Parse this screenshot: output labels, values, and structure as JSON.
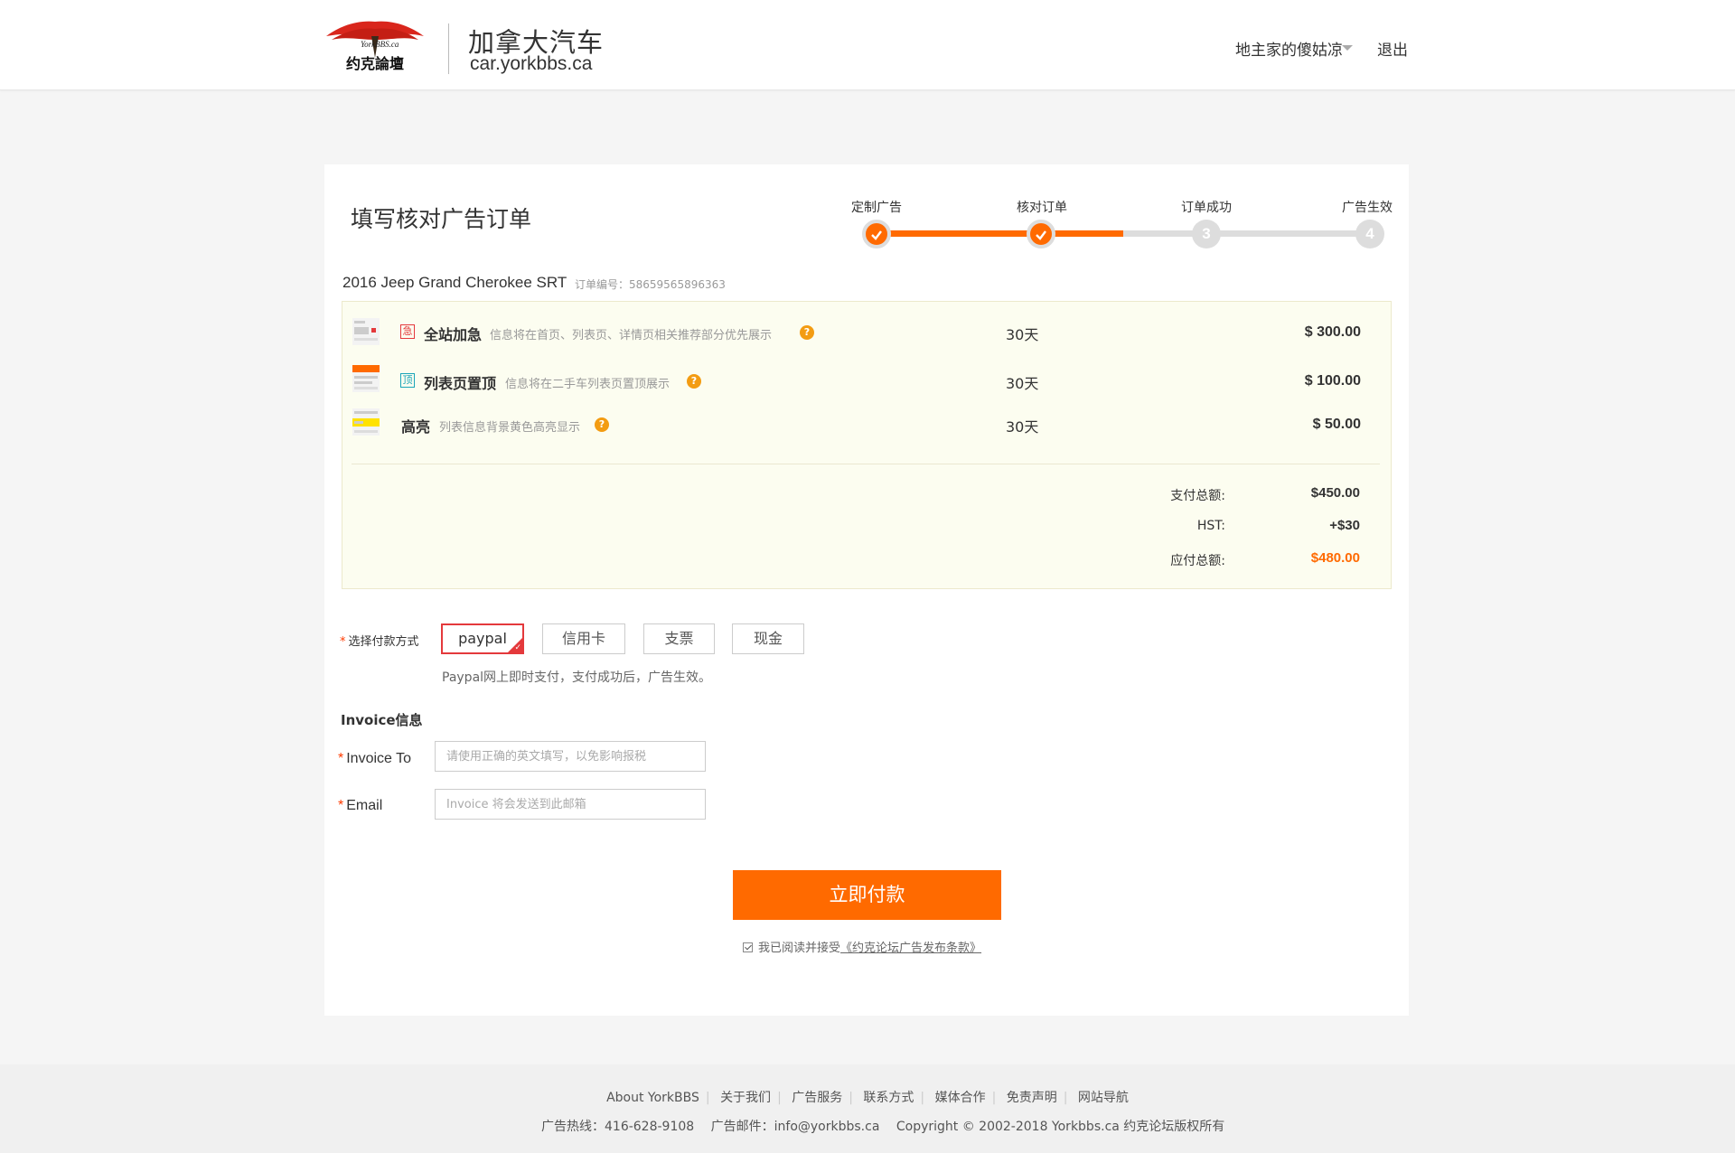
{
  "header": {
    "site_title": "加拿大汽车",
    "site_url": "car.yorkbbs.ca",
    "logo_text": "YorkBBS.ca 约克论坛",
    "user_name": "地主家的傻姑凉",
    "logout": "退出"
  },
  "page": {
    "title": "填写核对广告订单",
    "steps": [
      {
        "label": "定制广告",
        "number": "1",
        "status": "done"
      },
      {
        "label": "核对订单",
        "number": "2",
        "status": "done"
      },
      {
        "label": "订单成功",
        "number": "3",
        "status": "pending"
      },
      {
        "label": "广告生效",
        "number": "4",
        "status": "pending"
      }
    ],
    "progress_fraction": 0.5
  },
  "order": {
    "car_title": "2016 Jeep Grand Cherokee SRT",
    "order_no": "订单编号：58659565896363",
    "items": [
      {
        "badge": "急",
        "name": "全站加急",
        "desc": "信息将在首页、列表页、详情页相关推荐部分优先展示",
        "help": "?",
        "days": "30天",
        "price": "$ 300.00"
      },
      {
        "badge": "顶",
        "name": "列表页置顶",
        "desc": "信息将在二手车列表页置顶展示",
        "help": "?",
        "days": "30天",
        "price": "$ 100.00"
      },
      {
        "badge": "",
        "name": "高亮",
        "desc": "列表信息背景黄色高亮显示",
        "help": "?",
        "days": "30天",
        "price": "$ 50.00"
      }
    ],
    "summary": {
      "subtotal_label": "支付总额:",
      "subtotal": "$450.00",
      "hst_label": "HST:",
      "hst": "+$30",
      "total_label": "应付总额:",
      "total": "$480.00"
    }
  },
  "payment": {
    "required_mark": "*",
    "label": "选择付款方式",
    "methods": [
      "paypal",
      "信用卡",
      "支票",
      "现金"
    ],
    "selected": "paypal",
    "note": "Paypal网上即时支付，支付成功后，广告生效。"
  },
  "invoice": {
    "title": "Invoice信息",
    "invoice_to_label": "Invoice To",
    "invoice_to_placeholder": "请使用正确的英文填写，以免影响报税",
    "email_label": "Email",
    "email_placeholder": "Invoice 将会发送到此邮箱"
  },
  "submit": {
    "label": "立即付款",
    "agree_prefix": "我已阅读并接受",
    "agree_link": "《约克论坛广告发布条款》"
  },
  "footer": {
    "links": [
      "About YorkBBS",
      "关于我们",
      "广告服务",
      "联系方式",
      "媒体合作",
      "免责声明",
      "网站导航"
    ],
    "hotline": "广告热线：416-628-9108",
    "email": "广告邮件：info@yorkbbs.ca",
    "copyright": "Copyright © 2002-2018 Yorkbbs.ca 约克论坛版权所有"
  },
  "colors": {
    "accent": "#ff6a00",
    "selected_border": "#e4393c",
    "order_box_bg": "#fcfdf0",
    "help_icon": "#f39c12"
  }
}
